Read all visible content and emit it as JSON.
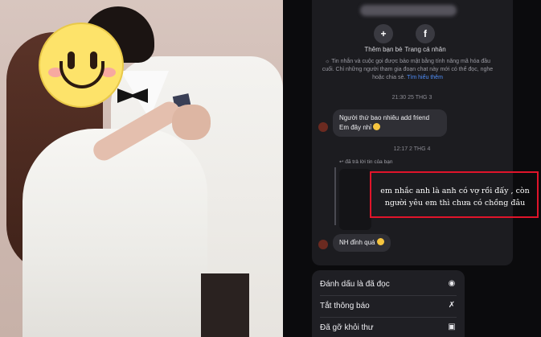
{
  "chat": {
    "actions": [
      {
        "label": "Thêm bạn bè",
        "icon": "add-person-icon"
      },
      {
        "label": "Trang cá nhân",
        "icon": "facebook-icon"
      }
    ],
    "encryption_notice": "Tin nhắn và cuộc gọi được bảo mật bằng tính năng mã hóa đầu cuối. Chỉ những người tham gia đoạn chat này mới có thể đọc, nghe hoặc chia sẻ.",
    "learn_more": "Tìm hiểu thêm",
    "timestamps": [
      "21:30 25 THG 3",
      "12:17 2 THG 4"
    ],
    "messages": [
      {
        "line1": "Người thứ bao nhiêu add friend",
        "line2": "Em đây nhỉ"
      },
      {
        "text": "NH đỉnh quá"
      }
    ],
    "reply_note": "đã trả lời tin của bạn",
    "highlighted_text": "em nhắc anh là anh có vợ rồi đấy , còn người yêu em thì chưa có chồng đâu"
  },
  "menu": {
    "items": [
      {
        "label": "Đánh dấu là đã đọc",
        "icon": "mark-read-icon"
      },
      {
        "label": "Tắt thông báo",
        "icon": "mute-bell-icon"
      },
      {
        "label": "Đã gỡ khỏi thư",
        "icon": "folder-icon"
      }
    ]
  },
  "colors": {
    "highlight": "#e0142a",
    "link": "#4f8df7",
    "smiley": "#fde36a"
  }
}
